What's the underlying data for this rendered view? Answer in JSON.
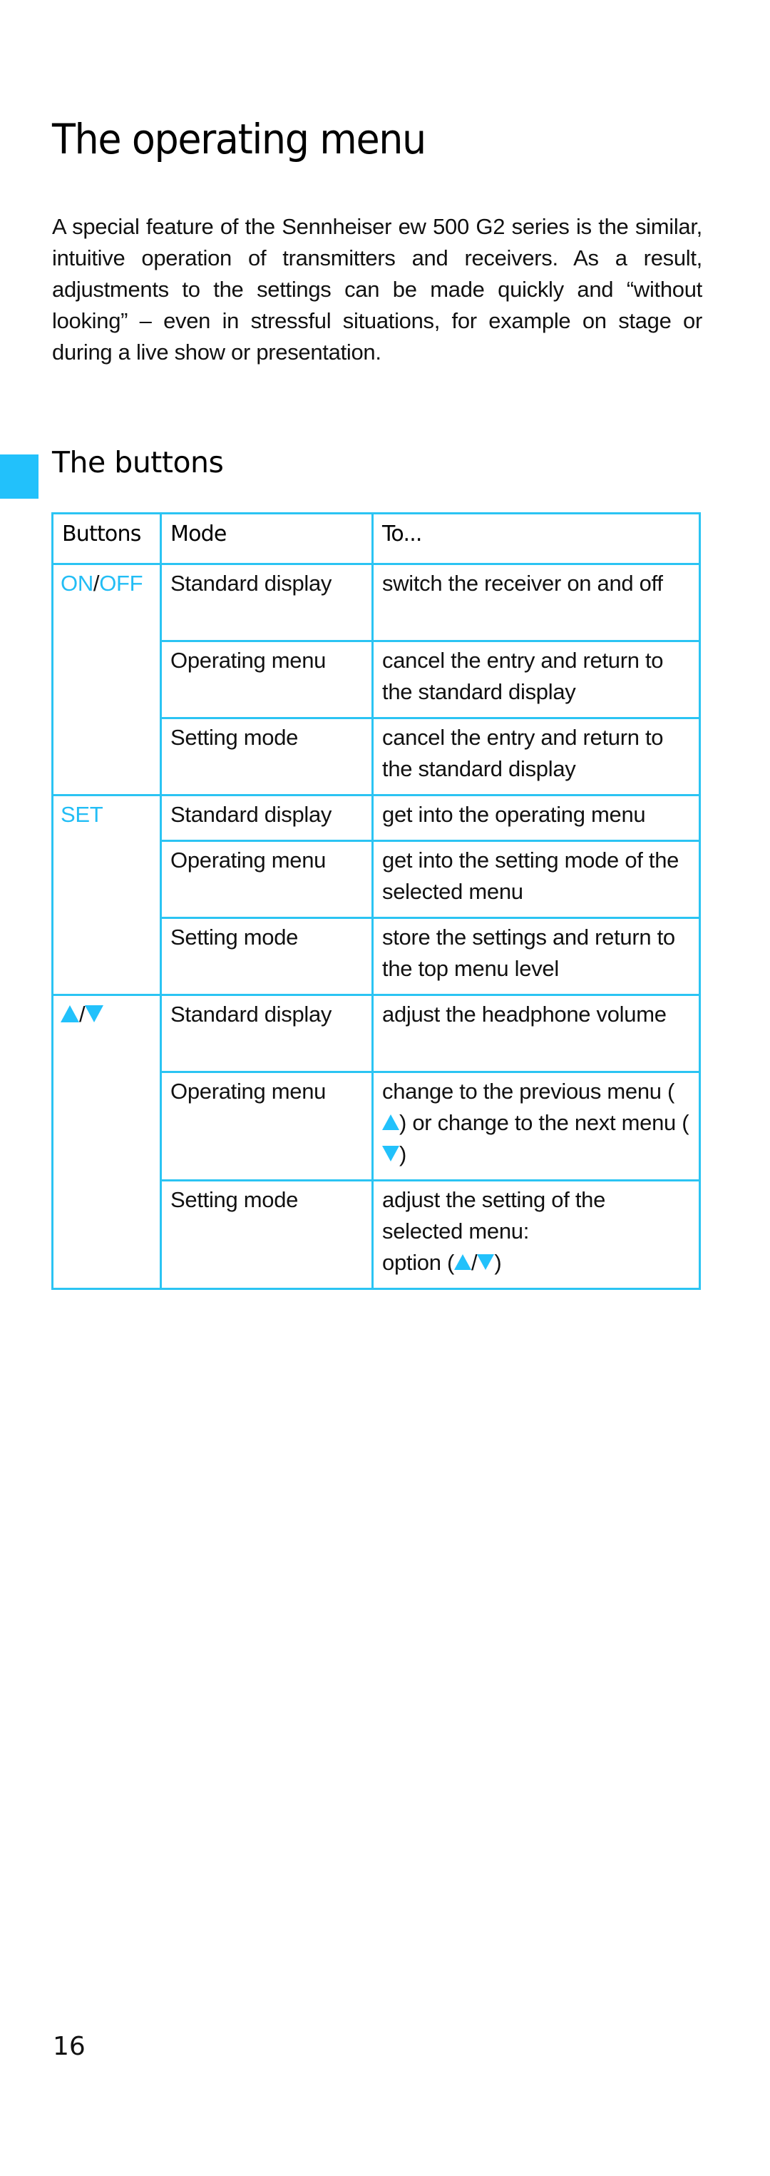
{
  "page": {
    "title": "The operating menu",
    "intro": "A special feature of the Sennheiser ew 500 G2 series is the similar, intuitive operation of transmitters and receivers. As a result, adjustments to the settings can be made quickly and “without looking” – even in stressful situations, for example on stage or during a live show or presentation.",
    "section_title": "The buttons",
    "page_number": "16",
    "accent_color": "#22c1fb"
  },
  "table": {
    "headers": [
      "Buttons",
      "Mode",
      "To..."
    ],
    "groups": [
      {
        "button": {
          "part1": "ON",
          "separator": "/",
          "part2": "OFF",
          "icons": []
        },
        "rows": [
          {
            "mode": "Standard display",
            "action": "switch the receiver on and off"
          },
          {
            "mode": "Operating menu",
            "action": "cancel the entry and return to the standard display"
          },
          {
            "mode": "Setting mode",
            "action": "cancel the entry and return to the standard display"
          }
        ]
      },
      {
        "button": {
          "label": "SET"
        },
        "rows": [
          {
            "mode": "Standard display",
            "action": "get into the operating menu"
          },
          {
            "mode": "Operating menu",
            "action": "get into the setting mode of the selected menu"
          },
          {
            "mode": "Setting mode",
            "action": "store the settings and return to the top menu level"
          }
        ]
      },
      {
        "button": {
          "icon_up": "triangle-up-icon",
          "separator": "/",
          "icon_down": "triangle-down-icon"
        },
        "rows": [
          {
            "mode": "Standard display",
            "action": "adjust the headphone volume"
          },
          {
            "mode": "Operating menu",
            "action_parts": [
              "change to the previous menu (",
              ") or change to the next menu (",
              ")"
            ]
          },
          {
            "mode": "Setting mode",
            "action_parts": [
              "adjust the setting of the selected menu:",
              "option (",
              "/",
              ")"
            ]
          }
        ]
      }
    ]
  }
}
